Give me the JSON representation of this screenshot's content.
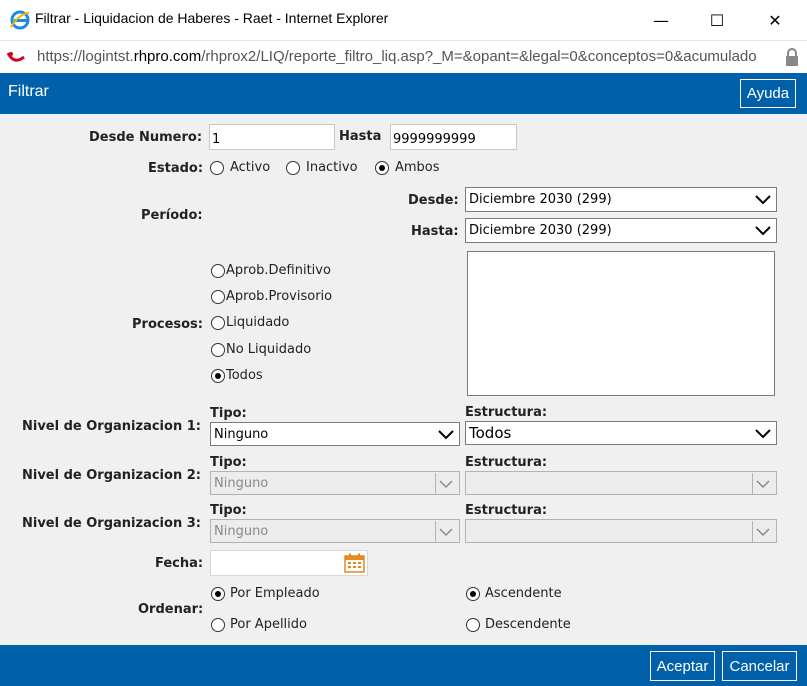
{
  "window": {
    "title": "Filtrar - Liquidacion de Haberes - Raet - Internet Explorer",
    "minimize_glyph": "—",
    "maximize_glyph": "☐",
    "close_glyph": "✕"
  },
  "address": {
    "url_prefix": "https://logintst.",
    "url_domain": "rhpro.com",
    "url_rest": "/rhprox2/LIQ/reporte_filtro_liq.asp?_M=&opant=&legal=0&conceptos=0&acumulado"
  },
  "header": {
    "title": "Filtrar",
    "help_label": "Ayuda"
  },
  "form": {
    "desde_numero_label": "Desde Numero:",
    "desde_numero_value": "1",
    "hasta_label": "Hasta",
    "hasta_value": "9999999999",
    "estado_label": "Estado:",
    "estado_options": [
      "Activo",
      "Inactivo",
      "Ambos"
    ],
    "estado_selected": "Ambos",
    "periodo_label": "Período:",
    "periodo_desde_label": "Desde:",
    "periodo_desde_value": "Diciembre 2030 (299)",
    "periodo_hasta_label": "Hasta:",
    "periodo_hasta_value": "Diciembre 2030 (299)",
    "procesos_label": "Procesos:",
    "procesos_options": [
      "Aprob.Definitivo",
      "Aprob.Provisorio",
      "Liquidado",
      "No Liquidado",
      "Todos"
    ],
    "procesos_selected": "Todos",
    "nivel1_label": "Nivel de Organizacion 1:",
    "nivel2_label": "Nivel de Organizacion 2:",
    "nivel3_label": "Nivel de Organizacion 3:",
    "tipo_label": "Tipo:",
    "estructura_label": "Estructura:",
    "nivel1_tipo": "Ninguno",
    "nivel1_estructura": "Todos",
    "nivel2_tipo": "Ninguno",
    "nivel2_estructura": "",
    "nivel3_tipo": "Ninguno",
    "nivel3_estructura": "",
    "fecha_label": "Fecha:",
    "fecha_value": "",
    "ordenar_label": "Ordenar:",
    "ordenar_options": [
      "Por Empleado",
      "Por Apellido"
    ],
    "ordenar_selected": "Por Empleado",
    "direccion_options": [
      "Ascendente",
      "Descendente"
    ],
    "direccion_selected": "Ascendente"
  },
  "footer": {
    "accept_label": "Aceptar",
    "cancel_label": "Cancelar"
  },
  "colors": {
    "brand_blue": "#0060a9",
    "background": "#f0f0f0"
  }
}
